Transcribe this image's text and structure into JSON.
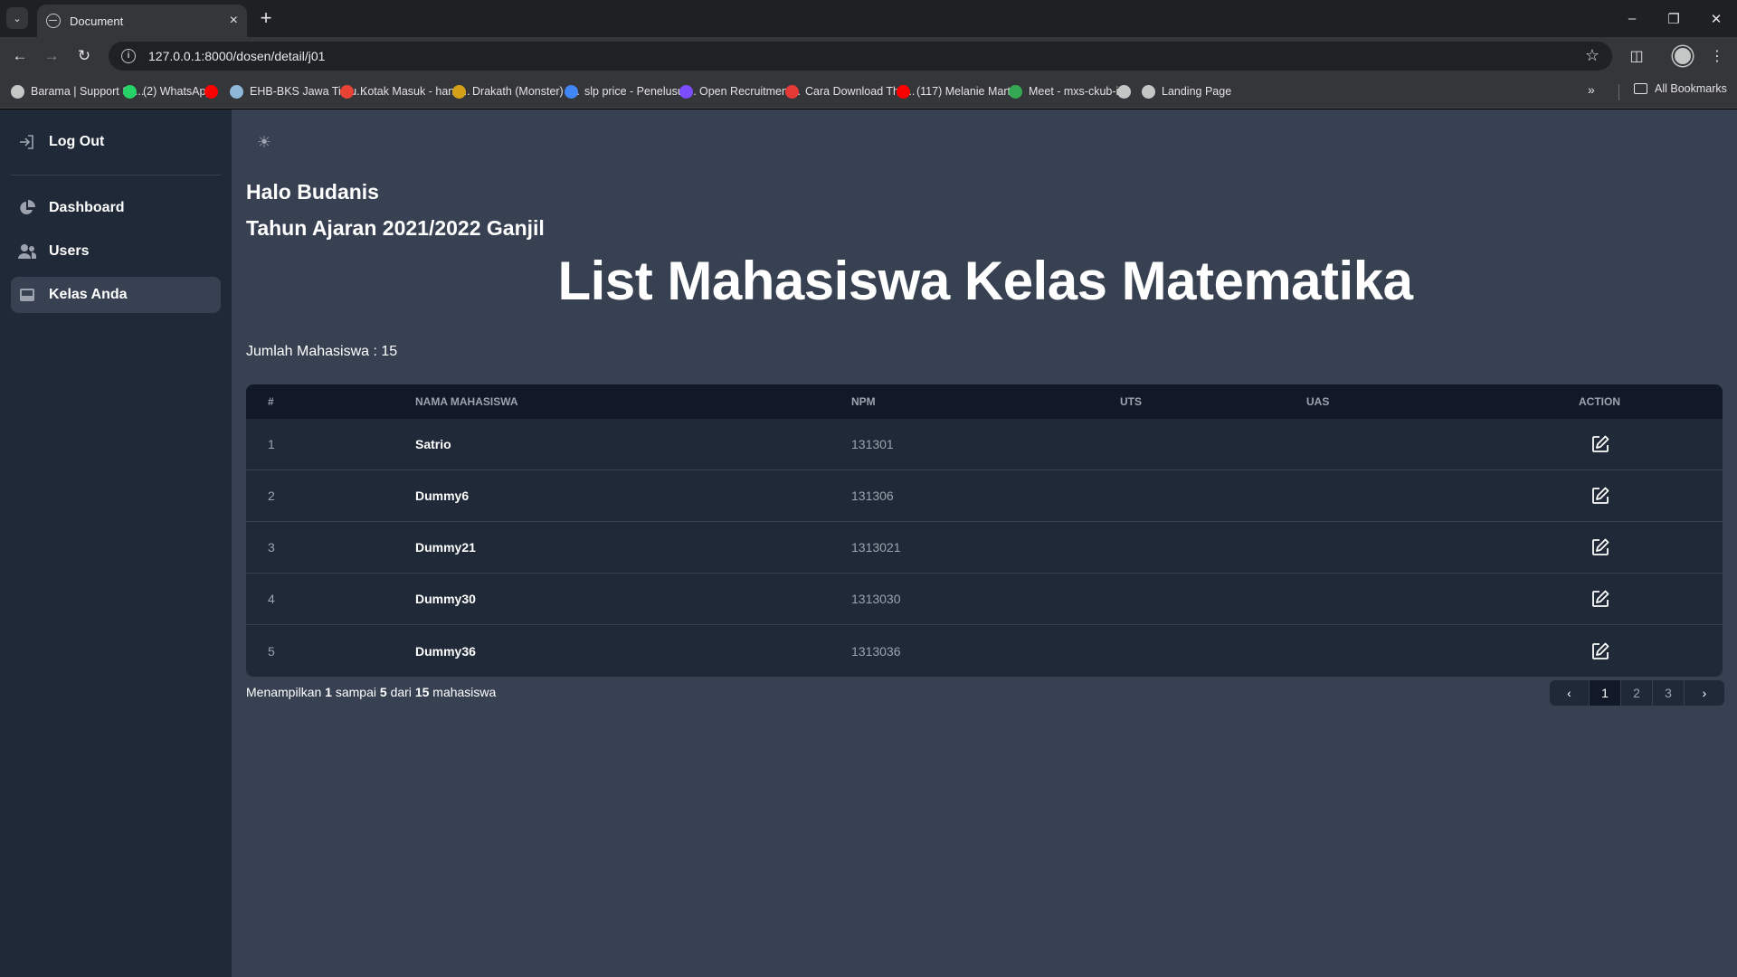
{
  "browser": {
    "tab_title": "Document",
    "url": "127.0.0.1:8000/dosen/detail/j01",
    "bookmarks": [
      {
        "label": "Barama | Support Sy...",
        "color": "#c4c7c5"
      },
      {
        "label": "(2) WhatsApp",
        "color": "#25d366"
      },
      {
        "label": "",
        "color": "#ff0000"
      },
      {
        "label": "EHB-BKS Jawa Timu...",
        "color": "#8fb8d8"
      },
      {
        "label": "Kotak Masuk - hand...",
        "color": "#ea4335"
      },
      {
        "label": "Drakath (Monster) (...",
        "color": "#d4a017"
      },
      {
        "label": "slp price - Penelusur...",
        "color": "#4285f4"
      },
      {
        "label": "Open Recruitment...",
        "color": "#7c4dff"
      },
      {
        "label": "Cara Download The...",
        "color": "#e53935"
      },
      {
        "label": "(117) Melanie Marti...",
        "color": "#ff0000"
      },
      {
        "label": "Meet - mxs-ckub-ige",
        "color": "#34a853"
      },
      {
        "label": "",
        "color": "#c4c7c5"
      },
      {
        "label": "Landing Page",
        "color": "#c4c7c5"
      }
    ],
    "all_bookmarks": "All Bookmarks"
  },
  "sidebar": {
    "logout": "Log Out",
    "items": [
      {
        "label": "Dashboard",
        "icon": "pie-chart-icon"
      },
      {
        "label": "Users",
        "icon": "users-icon"
      },
      {
        "label": "Kelas Anda",
        "icon": "inbox-icon"
      }
    ]
  },
  "main": {
    "greeting": "Halo Budanis",
    "year": "Tahun Ajaran 2021/2022 Ganjil",
    "title": "List Mahasiswa Kelas Matematika",
    "count_label": "Jumlah Mahasiswa : 15"
  },
  "table": {
    "headers": [
      "#",
      "Nama Mahasiswa",
      "NPM",
      "UTS",
      "UAS",
      "Action"
    ],
    "rows": [
      {
        "no": "1",
        "name": "Satrio",
        "npm": "131301",
        "uts": "",
        "uas": ""
      },
      {
        "no": "2",
        "name": "Dummy6",
        "npm": "131306",
        "uts": "",
        "uas": ""
      },
      {
        "no": "3",
        "name": "Dummy21",
        "npm": "1313021",
        "uts": "",
        "uas": ""
      },
      {
        "no": "4",
        "name": "Dummy30",
        "npm": "1313030",
        "uts": "",
        "uas": ""
      },
      {
        "no": "5",
        "name": "Dummy36",
        "npm": "1313036",
        "uts": "",
        "uas": ""
      }
    ]
  },
  "pagination": {
    "prefix": "Menampilkan",
    "from": "1",
    "mid1": "sampai",
    "to": "5",
    "mid2": "dari",
    "total": "15",
    "suffix": "mahasiswa",
    "pages": [
      "1",
      "2",
      "3"
    ],
    "current": "1"
  }
}
